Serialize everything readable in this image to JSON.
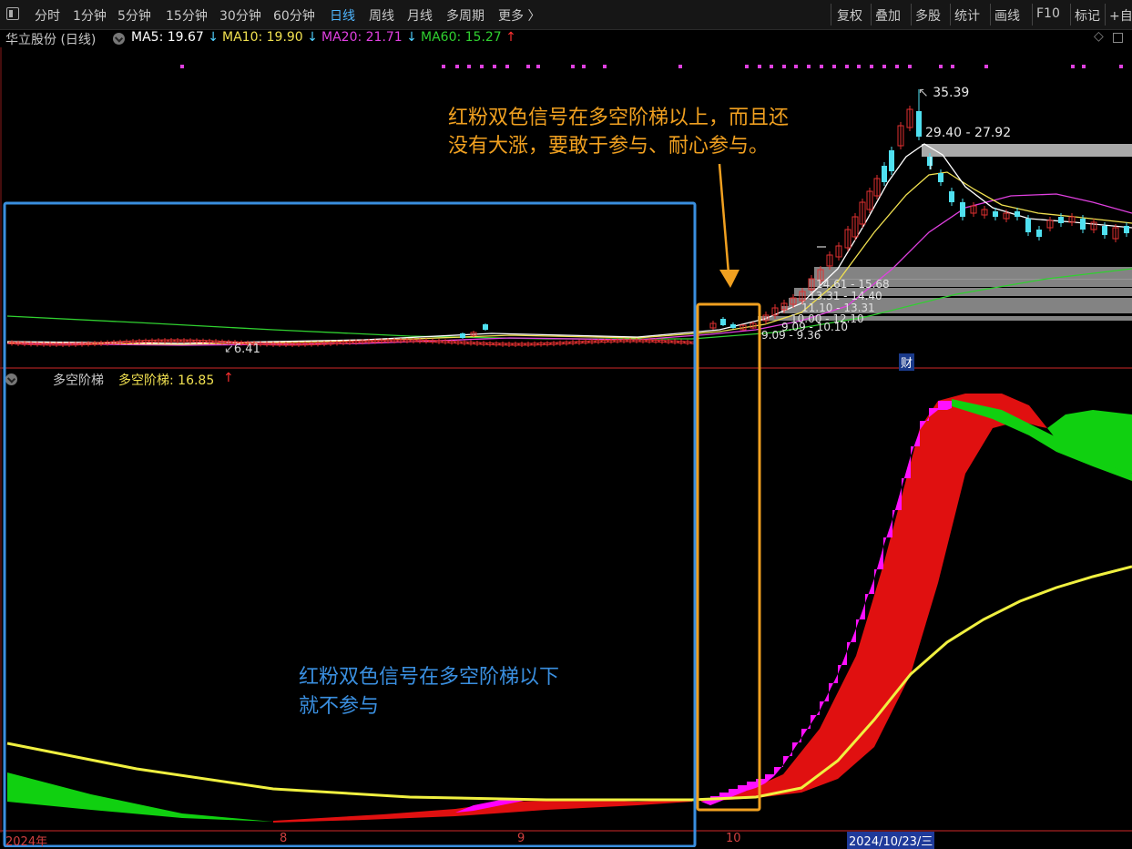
{
  "toolbar": {
    "left_items": [
      "分时",
      "1分钟",
      "5分钟",
      "15分钟",
      "30分钟",
      "60分钟",
      "日线",
      "周线",
      "月线",
      "多周期",
      "更多 〉"
    ],
    "active": "日线",
    "right_items": [
      "复权",
      "叠加",
      "多股",
      "统计",
      "画线",
      "F10",
      "标记",
      "+自"
    ]
  },
  "main": {
    "stock": "华立股份 (日线)",
    "ma": [
      {
        "label": "MA5: 19.67",
        "arrow": "↓",
        "color": "#ffffff",
        "arrow_color": "#4fd0ff"
      },
      {
        "label": "MA10: 19.90",
        "arrow": "↓",
        "color": "#f0e050",
        "arrow_color": "#4fd0ff"
      },
      {
        "label": "MA20: 21.71",
        "arrow": "↓",
        "color": "#e040e0",
        "arrow_color": "#4fd0ff"
      },
      {
        "label": "MA60: 15.27",
        "arrow": "↑",
        "color": "#30d030",
        "arrow_color": "#ff3030"
      }
    ],
    "high_label": "35.39",
    "low_label": "6.41",
    "top_band_label": "29.40 - 27.92",
    "bands": [
      "14.61 - 15.68",
      "13.31 - 14.40",
      "11.10 - 13.31",
      "10.00 - 12.10",
      "9.09 - 10.10",
      "9.09 - 9.36"
    ],
    "cai_label": "财",
    "diamond_icon": "diamond-icon"
  },
  "sub": {
    "name": "多空阶梯",
    "value_label": "多空阶梯: 16.85",
    "arrow": "↑"
  },
  "annotations": {
    "orange_line1": "红粉双色信号在多空阶梯以上，而且还",
    "orange_line2": "没有大涨，要敢于参与、耐心参与。",
    "blue_line1": "红粉双色信号在多空阶梯以下",
    "blue_line2": "就不参与"
  },
  "axis": {
    "year": "2024年",
    "m8": "8",
    "m9": "9",
    "m10": "10",
    "date": "2024/10/23/三"
  },
  "colors": {
    "up": "#e03030",
    "down": "#4fe0f0",
    "ma5": "#ffffff",
    "ma10": "#f0e050",
    "ma20": "#e040e0",
    "ma60": "#30d030",
    "annot_orange": "#f0a020",
    "annot_blue": "#3a8fe0"
  }
}
